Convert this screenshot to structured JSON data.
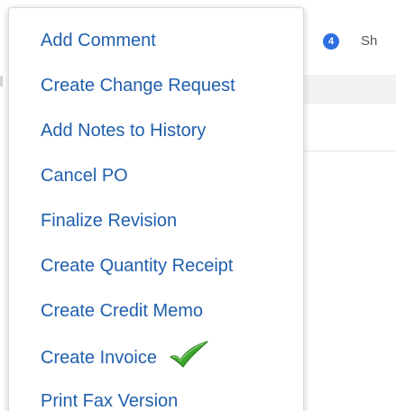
{
  "background": {
    "tab_badge_count": "4",
    "tab_label_clipped": "Sh"
  },
  "menu": {
    "items": [
      {
        "label": "Add Comment"
      },
      {
        "label": "Create Change Request"
      },
      {
        "label": "Add Notes to History"
      },
      {
        "label": "Cancel PO"
      },
      {
        "label": "Finalize Revision"
      },
      {
        "label": "Create Quantity Receipt"
      },
      {
        "label": "Create Credit Memo"
      },
      {
        "label": "Create Invoice",
        "annotation_icon": "green-checkmark-icon"
      },
      {
        "label": "Print Fax Version"
      }
    ]
  },
  "colors": {
    "menu_text": "#1f5fad",
    "badge_bg": "#2f6fe0",
    "checkmark": "#3aa52b"
  }
}
